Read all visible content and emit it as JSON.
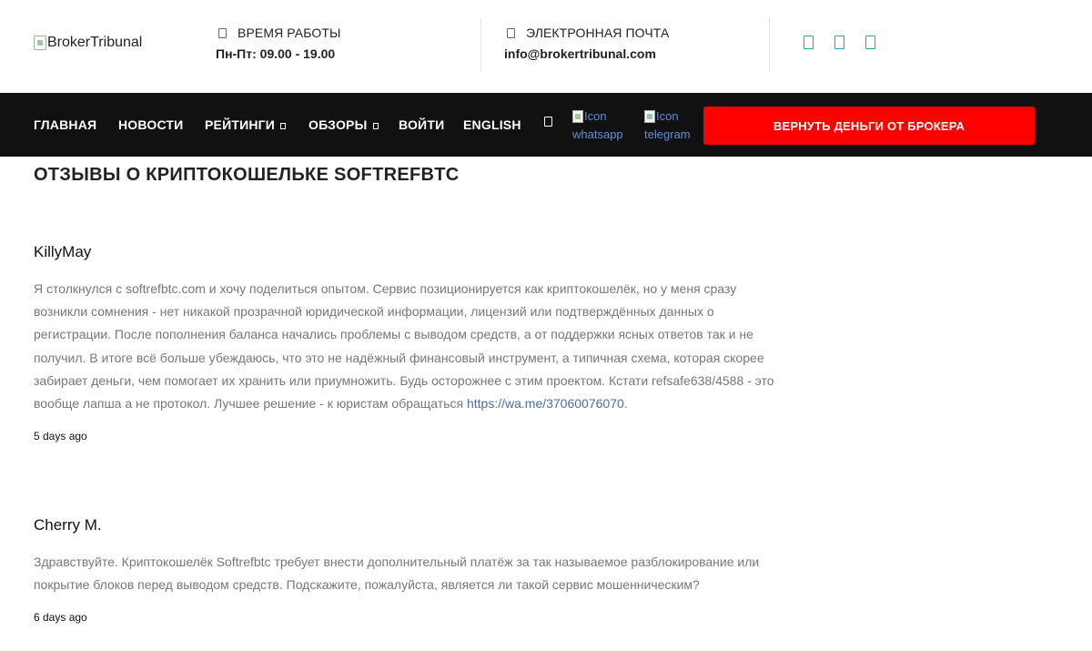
{
  "header": {
    "logo_alt": "BrokerTribunal",
    "hours": {
      "label": "ВРЕМЯ РАБОТЫ",
      "value": "Пн-Пт: 09.00 - 19.00"
    },
    "email": {
      "label": "ЭЛЕКТРОННАЯ ПОЧТА",
      "value": "info@brokertribunal.com"
    },
    "social_icons": [
      "social-icon-1",
      "social-icon-2",
      "social-icon-3"
    ]
  },
  "nav": {
    "items": [
      {
        "label": "ГЛАВНАЯ"
      },
      {
        "label": "НОВОСТИ"
      },
      {
        "label": "РЕЙТИНГИ"
      },
      {
        "label": "ОБЗОРЫ"
      },
      {
        "label": "ВОЙТИ"
      },
      {
        "label": "ENGLISH"
      }
    ],
    "whatsapp": {
      "alt": "Icon",
      "label": "whatsapp"
    },
    "telegram": {
      "alt": "Icon",
      "label": "telegram"
    },
    "cta_label": "ВЕРНУТЬ ДЕНЬГИ ОТ БРОКЕРА"
  },
  "page": {
    "title": "ОТЗЫВЫ О КРИПТОКОШЕЛЬКЕ SOFTREFBTC"
  },
  "reviews": [
    {
      "author": "KillyMay",
      "text": "Я столкнулся с softrefbtc.com и хочу поделиться опытом. Сервис позиционируется как криптокошелёк, но у меня сразу возникли сомнения - нет никакой прозрачной юридической информации, лицензий или подтверждённых данных о регистрации. После пополнения баланса начались проблемы с выводом средств, а от поддержки ясных ответов так и не получил. В итоге всё больше убеждаюсь, что это не надёжный финансовый инструмент, а типичная схема, которая скорее забирает деньги, чем помогает их хранить или приумножить. Будь осторожнее с этим проектом. Кстати refsafe638/4588 - это вообще лапша а не протокол. Лучшее решение - к юристам обращаться ",
      "link": "https://wa.me/37060076070",
      "link_suffix": ".",
      "date": "5 days ago"
    },
    {
      "author": "Cherry M.",
      "text": "Здравствуйте. Криптокошелёк Softrefbtc требует внести дополнительный платёж за так называемое разблокирование или покрытие блоков перед выводом средств. Подскажите, пожалуйста, является ли такой сервис мошенническим?",
      "date": "6 days ago"
    }
  ]
}
